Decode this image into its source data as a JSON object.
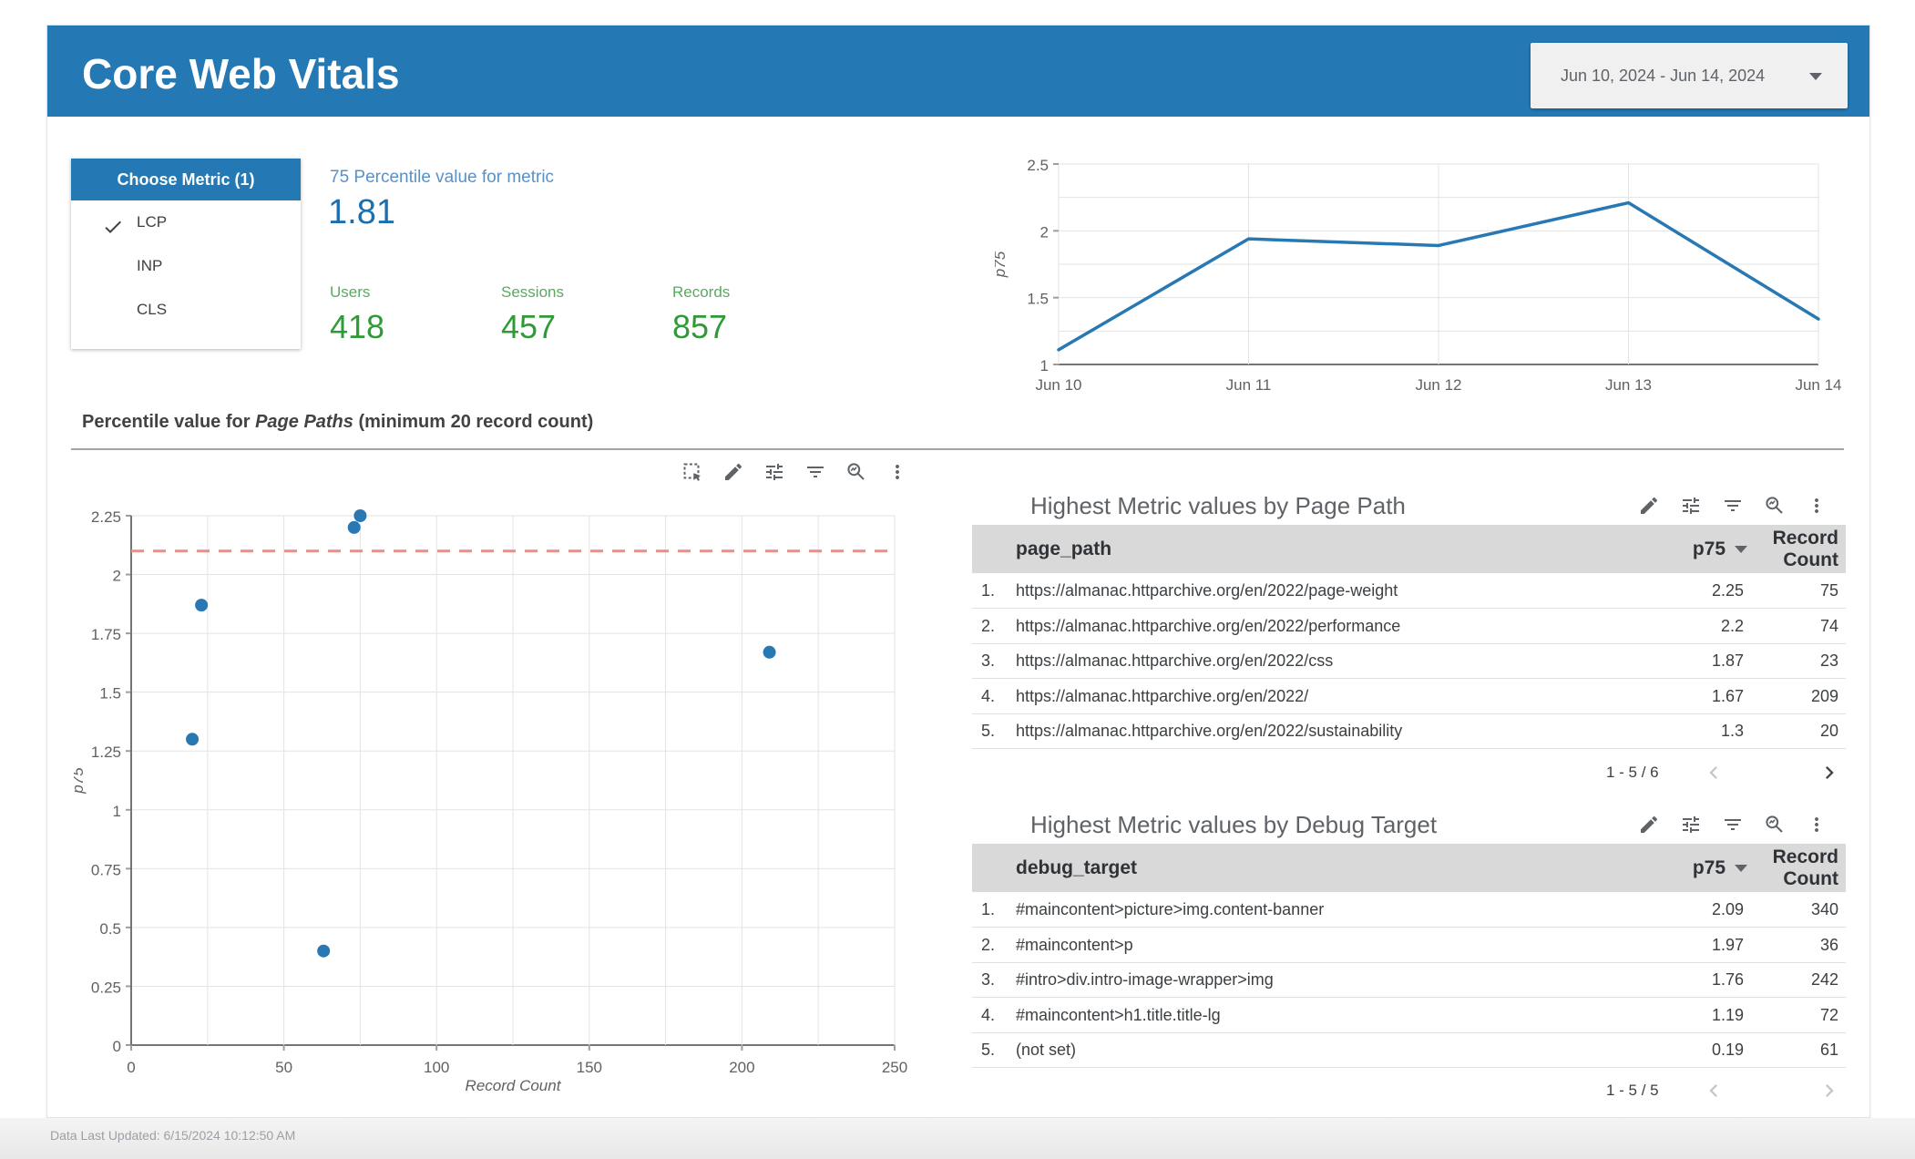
{
  "page": {
    "title": "Core Web Vitals",
    "date_range": "Jun 10, 2024 - Jun 14, 2024",
    "footer": "Data Last Updated: 6/15/2024 10:12:50 AM"
  },
  "metric_selector": {
    "header": "Choose Metric (1)",
    "options": [
      {
        "label": "LCP",
        "selected": true
      },
      {
        "label": "INP",
        "selected": false
      },
      {
        "label": "CLS",
        "selected": false
      }
    ]
  },
  "kpis": {
    "percentile_label": "75 Percentile value for metric",
    "percentile_value": "1.81",
    "stats": [
      {
        "label": "Users",
        "value": "418"
      },
      {
        "label": "Sessions",
        "value": "457"
      },
      {
        "label": "Records",
        "value": "857"
      }
    ]
  },
  "section": {
    "heading_prefix": "Percentile value for ",
    "heading_italic": "Page Paths",
    "heading_suffix": " (minimum 20 record count)"
  },
  "chart_data": [
    {
      "type": "line",
      "title": "p75 by date",
      "x": [
        "Jun 10",
        "Jun 11",
        "Jun 12",
        "Jun 13",
        "Jun 14"
      ],
      "series": [
        {
          "name": "p75",
          "values": [
            1.11,
            1.94,
            1.89,
            2.21,
            1.34
          ]
        }
      ],
      "xlabel": "",
      "ylabel": "p75",
      "ylim": [
        1,
        2.5
      ],
      "ytick_labels": [
        1,
        1.5,
        2,
        2.5
      ],
      "grid_step": 0.25,
      "grid": true,
      "legend": false,
      "line_color": "#2878b4"
    },
    {
      "type": "scatter",
      "title": "Percentile value for Page Paths (minimum 20 record count)",
      "points": [
        {
          "x": 75,
          "y": 2.25
        },
        {
          "x": 73,
          "y": 2.2
        },
        {
          "x": 23,
          "y": 1.87
        },
        {
          "x": 209,
          "y": 1.67
        },
        {
          "x": 20,
          "y": 1.3
        },
        {
          "x": 63,
          "y": 0.4
        }
      ],
      "xlabel": "Record Count",
      "ylabel": "p75",
      "xlim": [
        0,
        250
      ],
      "ylim": [
        0,
        2.25
      ],
      "xtick_labels": [
        0,
        50,
        100,
        150,
        200,
        250
      ],
      "x_grid_step": 25,
      "y_grid_step": 0.25,
      "grid": true,
      "reference_line_y": 2.1,
      "reference_line_color": "#f28b82",
      "point_color": "#2878b4"
    }
  ],
  "tables": [
    {
      "title": "Highest Metric values by Page Path",
      "dim_header": "page_path",
      "metric_header": "p75",
      "count_header_line1": "Record",
      "count_header_line2": "Count",
      "rows": [
        {
          "index": "1.",
          "dim": "https://almanac.httparchive.org/en/2022/page-weight",
          "p75": "2.25",
          "count": "75"
        },
        {
          "index": "2.",
          "dim": "https://almanac.httparchive.org/en/2022/performance",
          "p75": "2.2",
          "count": "74"
        },
        {
          "index": "3.",
          "dim": "https://almanac.httparchive.org/en/2022/css",
          "p75": "1.87",
          "count": "23"
        },
        {
          "index": "4.",
          "dim": "https://almanac.httparchive.org/en/2022/",
          "p75": "1.67",
          "count": "209"
        },
        {
          "index": "5.",
          "dim": "https://almanac.httparchive.org/en/2022/sustainability",
          "p75": "1.3",
          "count": "20"
        }
      ],
      "pagination": "1 - 5 / 6",
      "prev_enabled": false,
      "next_enabled": true
    },
    {
      "title": "Highest Metric values by Debug Target",
      "dim_header": "debug_target",
      "metric_header": "p75",
      "count_header_line1": "Record",
      "count_header_line2": "Count",
      "rows": [
        {
          "index": "1.",
          "dim": "#maincontent>picture>img.content-banner",
          "p75": "2.09",
          "count": "340"
        },
        {
          "index": "2.",
          "dim": "#maincontent>p",
          "p75": "1.97",
          "count": "36"
        },
        {
          "index": "3.",
          "dim": "#intro>div.intro-image-wrapper>img",
          "p75": "1.76",
          "count": "242"
        },
        {
          "index": "4.",
          "dim": "#maincontent>h1.title.title-lg",
          "p75": "1.19",
          "count": "72"
        },
        {
          "index": "5.",
          "dim": "(not set)",
          "p75": "0.19",
          "count": "61"
        }
      ],
      "pagination": "1 - 5 / 5",
      "prev_enabled": false,
      "next_enabled": false
    }
  ],
  "colors": {
    "banner": "#2478b4",
    "kpi_blue_label": "#5a91c5",
    "kpi_blue_value": "#1c6fae",
    "kpi_green_label": "#59aa5e",
    "kpi_green_value": "#2e9b36",
    "line": "#2878b4",
    "point": "#2878b4",
    "reference_line": "#f28b82",
    "table_header_bg": "#d9d9d9",
    "icon": "#5f6368"
  }
}
